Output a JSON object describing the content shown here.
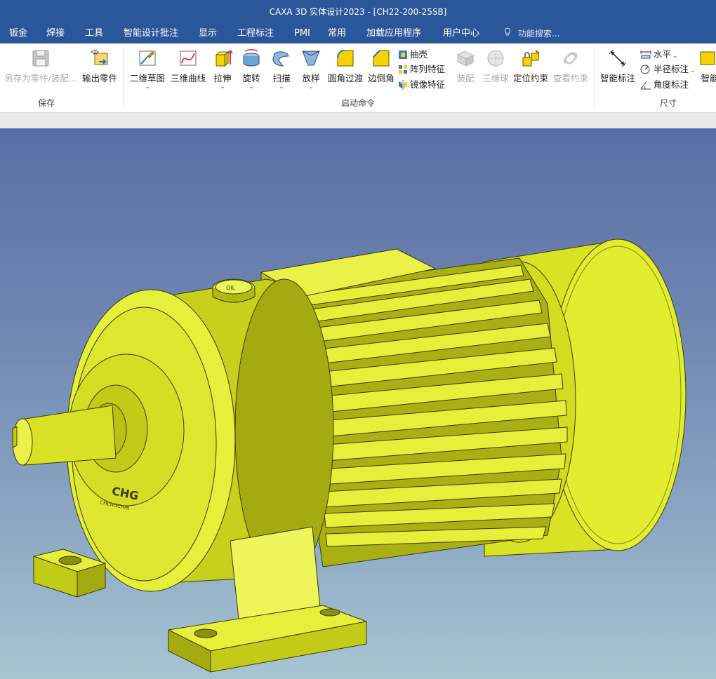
{
  "window": {
    "title": "CAXA 3D 实体设计2023 - [CH22-200-25SB]"
  },
  "menu": {
    "items": [
      "钣金",
      "焊接",
      "工具",
      "智能设计批注",
      "显示",
      "工程标注",
      "PMI",
      "常用",
      "加载应用程序",
      "用户中心"
    ],
    "search_placeholder": "功能搜索..."
  },
  "ribbon": {
    "save_group": {
      "label": "保存",
      "save_as": "另存为零件/装配...",
      "export_part": "输出零件"
    },
    "launch_group": {
      "label": "启动命令",
      "sketch2d": "二维草图",
      "curve3d": "三维曲线",
      "extrude": "拉伸",
      "revolve": "旋转",
      "sweep": "扫描",
      "loft": "放样",
      "fillet": "圆角过渡",
      "chamfer": "边倒角",
      "shell": "抽壳",
      "pattern": "阵列特征",
      "mirror": "镜像特征",
      "assembly": "装配",
      "ball3d": "三维球",
      "constraint": "定位约束",
      "view_constraint": "查看约束"
    },
    "dimension_group": {
      "label": "尺寸",
      "smart_dim": "智能标注",
      "horizontal": "水平",
      "radius": "半径标注",
      "angle": "角度标注",
      "smart_partial": "智能"
    }
  },
  "model": {
    "logo_text": "CHG",
    "logo_subtext": "CHENGCHIN",
    "cap_text": "OIL",
    "body_color": "#e6f03a",
    "shade_color": "#c5cc1f",
    "dark_color": "#8a8f10",
    "edge_color": "#3a3a00"
  },
  "colors": {
    "titlebar": "#2b579a",
    "accent": "#2b579a"
  }
}
